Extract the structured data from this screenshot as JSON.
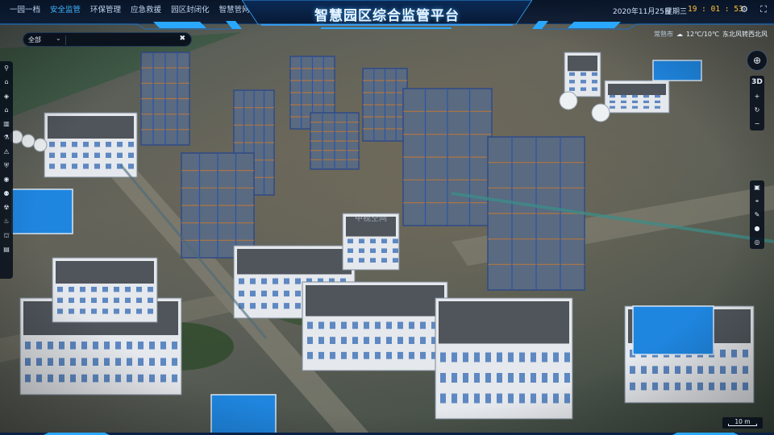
{
  "header": {
    "title": "智慧园区综合监管平台",
    "nav": [
      {
        "label": "一园一档",
        "active": false
      },
      {
        "label": "安全监管",
        "active": true
      },
      {
        "label": "环保管理",
        "active": false
      },
      {
        "label": "应急救援",
        "active": false
      },
      {
        "label": "园区封闭化",
        "active": false
      },
      {
        "label": "智慧管网",
        "active": false
      }
    ],
    "date": "2020年11月25日",
    "weekday": "星期三",
    "time": "19 : 01 : 53"
  },
  "search": {
    "selected": "全部",
    "placeholder": ""
  },
  "weather": {
    "location": "常熟市",
    "icon": "cloud-icon",
    "temperature": "12℃/10℃",
    "wind": "东北风转西北风"
  },
  "left_toolbar": [
    "pin-icon",
    "building-icon",
    "cube-icon",
    "house-icon",
    "factory-icon",
    "flask-icon",
    "warning-icon",
    "shield-icon",
    "alert-icon",
    "people-icon",
    "radiation-icon",
    "hazard-icon",
    "bank-icon",
    "document-icon"
  ],
  "right_controls": {
    "mode_label": "3D",
    "top_group": [
      "zoom-in-icon",
      "rotate-icon",
      "zoom-out-icon"
    ],
    "bottom_group": [
      "camera-icon",
      "location-icon",
      "edit-icon",
      "pin-icon",
      "target-icon"
    ]
  },
  "scale_label": "10 m",
  "watermark": "中视空间",
  "colors": {
    "accent": "#3fb6ff",
    "clock": "#ffc23a",
    "bar_bg": "#061226"
  }
}
